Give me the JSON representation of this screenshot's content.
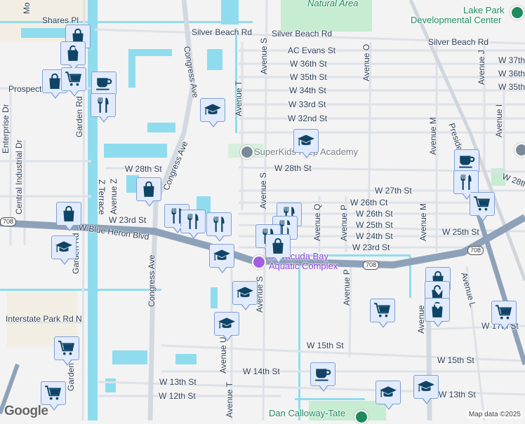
{
  "labels": [
    "Silver Beach Rd",
    "Silver Beach Rd",
    "Silver Beach Rd",
    "Shares Pl",
    "Natural Area",
    "Lake Park",
    "Developmental Center",
    "AC Evans St",
    "W 36th St",
    "W 35th St",
    "W 34th St",
    "W 33rd St",
    "W 32nd St",
    "SuperKids Prep Academy",
    "W 28th St",
    "W 28th St",
    "W 27th St",
    "W 26th Ct",
    "W 26th St",
    "W 25th St",
    "W 25th St",
    "W 24th St",
    "W 23rd St",
    "W 23rd St",
    "W Blue Heron Blvd",
    "Congress Ave",
    "Congress Ave",
    "Congress Ave",
    "Garden Rd",
    "Garden Rd",
    "Garden",
    "Enterprise Dr",
    "Central Industrial Dr",
    "Prospect Av",
    "Z Terrace",
    "Avenue Z",
    "Avenue T",
    "Avenue S",
    "Avenue S",
    "Avenue S",
    "Avenue O",
    "Avenue M",
    "Avenue M",
    "Avenue J",
    "Avenue I",
    "President",
    "Avenue Q",
    "Avenue P",
    "Avenue P",
    "Avenue L",
    "Barracuda Bay",
    "Aquatic Complex",
    "Interstate Park Rd N",
    "W 15th St",
    "W 15th St",
    "W 14th St",
    "W 13th St",
    "W 12th St",
    "W 13th St",
    "W 17th St",
    "Avenue U",
    "Avenue T",
    "Dan Calloway-Tate",
    "W 37th St",
    "W 36th St",
    "W 35th St",
    "W 28th St",
    "Mo",
    "Avenue"
  ],
  "route_shields": [
    "708",
    "708",
    "708"
  ],
  "credit": "Map data ©2025",
  "logo": "Google",
  "markers": [
    "shopping",
    "shopping",
    "shopping",
    "cart",
    "coffee",
    "dining",
    "school",
    "shopping",
    "school",
    "coffee",
    "dining",
    "cart",
    "shopping",
    "dining",
    "dining",
    "dining",
    "school",
    "school",
    "dining",
    "dining",
    "dining",
    "shopping",
    "school",
    "school",
    "cart",
    "shopping",
    "shopping",
    "shopping",
    "cart",
    "cart",
    "cart",
    "coffee",
    "school",
    "school"
  ],
  "colors": {
    "marker_icon": "#0f4466",
    "marker_bg": "#e2ebfb",
    "water": "#8fdcef",
    "highway": "#8da2b9",
    "park": "#c6ecd2"
  }
}
